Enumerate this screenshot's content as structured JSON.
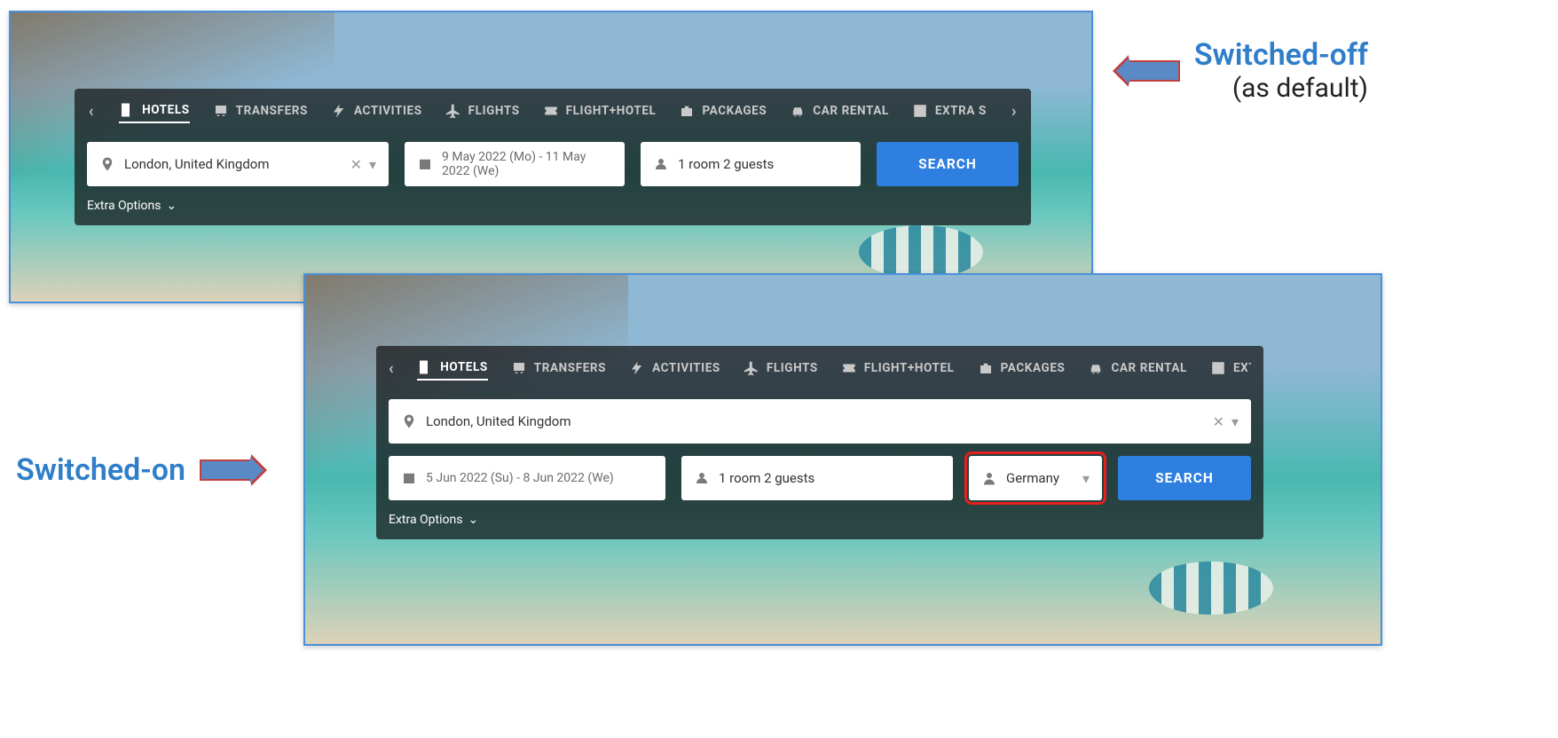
{
  "annotations": {
    "off_title": "Switched-off",
    "off_subtitle": "(as default)",
    "on_title": "Switched-on"
  },
  "tabs": {
    "hotels": "HOTELS",
    "transfers": "TRANSFERS",
    "activities": "ACTIVITIES",
    "flights": "FLIGHTS",
    "flight_hotel": "FLIGHT+HOTEL",
    "packages": "PACKAGES",
    "car_rental": "CAR RENTAL",
    "extra_s": "EXTRA S"
  },
  "panel1": {
    "destination": "London, United Kingdom",
    "date_range": "9 May 2022 (Mo) -  11 May 2022 (We)",
    "guests": "1 room 2 guests",
    "search_label": "SEARCH",
    "extra_options": "Extra Options"
  },
  "panel2": {
    "destination": "London, United Kingdom",
    "date_range": "5 Jun 2022 (Su) -  8 Jun 2022 (We)",
    "guests": "1 room 2 guests",
    "nationality": "Germany",
    "search_label": "SEARCH",
    "extra_options": "Extra Options"
  }
}
